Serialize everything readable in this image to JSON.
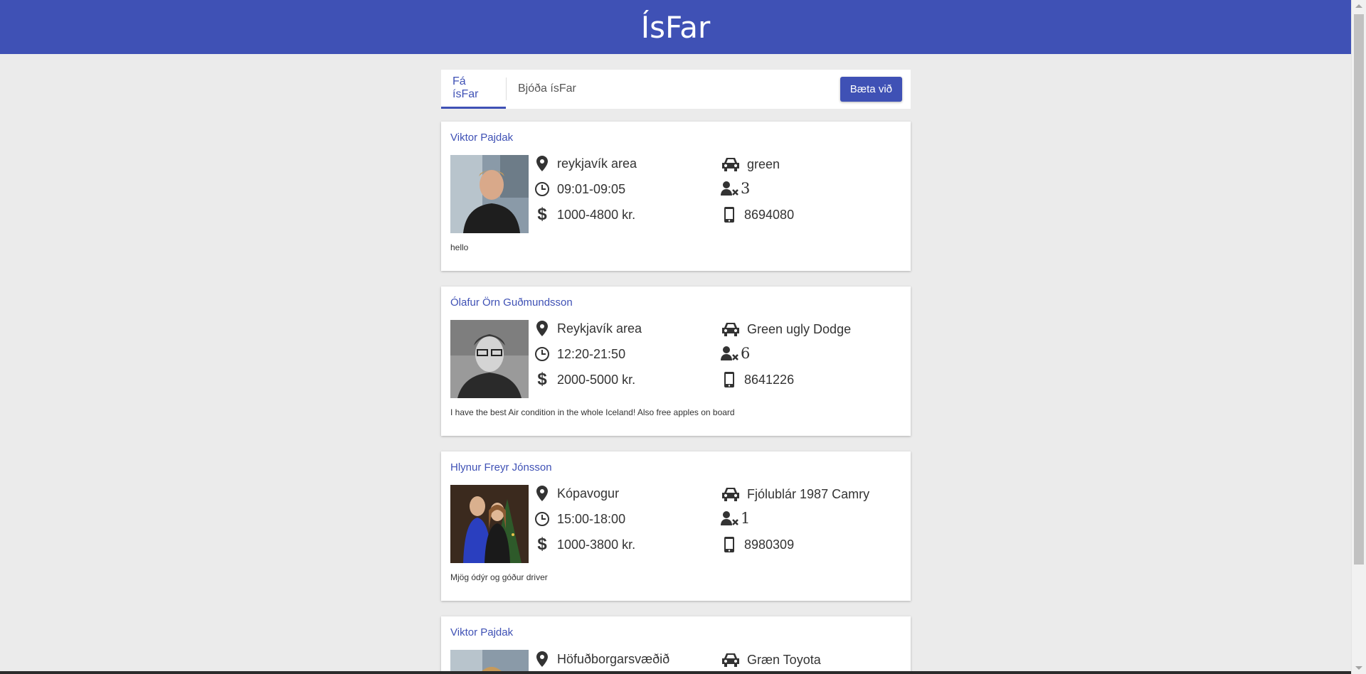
{
  "app": {
    "title": "ÍsFar"
  },
  "tabs": {
    "active_label": "Fá ísFar",
    "inactive_label": "Bjóða ísFar",
    "add_label": "Bæta við"
  },
  "theme": {
    "primary": "#3f51b5",
    "background": "#ebebeb"
  },
  "rides": [
    {
      "driver": "Viktor Pajdak",
      "location": "reykjavík area",
      "time": "09:01-09:05",
      "price": "1000-4800 kr.",
      "car": "green",
      "seats": "3",
      "phone": "8694080",
      "note": "hello"
    },
    {
      "driver": "Ólafur Örn Guðmundsson",
      "location": "Reykjavík area",
      "time": "12:20-21:50",
      "price": "2000-5000 kr.",
      "car": "Green ugly Dodge",
      "seats": "6",
      "phone": "8641226",
      "note": "I have the best Air condition in the whole Iceland! Also free apples on board"
    },
    {
      "driver": "Hlynur Freyr Jónsson",
      "location": "Kópavogur",
      "time": "15:00-18:00",
      "price": "1000-3800 kr.",
      "car": "Fjólublár 1987 Camry",
      "seats": "1",
      "phone": "8980309",
      "note": "Mjög ódýr og góður driver"
    },
    {
      "driver": "Viktor Pajdak",
      "location": "Höfuðborgarsvæðið",
      "car": "Græn Toyota"
    }
  ],
  "icons": {
    "location": "map-marker-icon",
    "time": "clock-icon",
    "price": "dollar-icon",
    "car": "car-icon",
    "seats": "user-x-icon",
    "phone": "phone-icon"
  }
}
